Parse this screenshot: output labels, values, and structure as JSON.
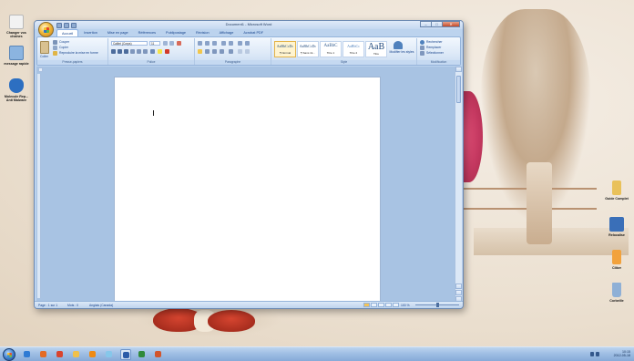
{
  "desktop": {
    "icons_left": [
      {
        "label": "Changer vos chaînes",
        "icon": "document-icon",
        "color": "#e8e8e8"
      },
      {
        "label": "message rapide",
        "icon": "envelope-icon",
        "color": "#8bb4e0"
      },
      {
        "label": "Molecule Rep... Anti Malware",
        "icon": "shield-icon",
        "color": "#2d6fc1"
      }
    ],
    "icons_right": [
      {
        "label": "Guide Complet",
        "icon": "folder-icon",
        "color": "#e9c15a"
      },
      {
        "label": "Relocalise",
        "icon": "computer-icon",
        "color": "#3a6fb8"
      },
      {
        "label": "Cliker",
        "icon": "cursor-icon",
        "color": "#f2a23c"
      },
      {
        "label": "Corbeille",
        "icon": "recycle-bin-icon",
        "color": "#8fb0d6"
      }
    ]
  },
  "word": {
    "title": "Document1 - Microsoft Word",
    "tabs": [
      "Accueil",
      "Insertion",
      "Mise en page",
      "Références",
      "Publipostage",
      "Révision",
      "Affichage",
      "Acrobat PDF"
    ],
    "active_tab": "Accueil",
    "clipboard": {
      "paste_label": "Coller",
      "cut": "Couper",
      "copy": "Copier",
      "format_painter": "Reproduire la mise en forme",
      "group_label": "Presse-papiers"
    },
    "font": {
      "name": "Calibri (Corps)",
      "size": "11",
      "group_label": "Police"
    },
    "paragraph": {
      "group_label": "Paragraphe"
    },
    "styles": {
      "items": [
        {
          "preview": "AaBbCcDc",
          "name": "¶ Normal",
          "selected": true
        },
        {
          "preview": "AaBbCcDc",
          "name": "¶ Sans int...",
          "selected": false
        },
        {
          "preview": "AaBbC",
          "name": "Titre 1",
          "selected": false
        },
        {
          "preview": "AaBbCc",
          "name": "Titre 2",
          "selected": false
        },
        {
          "preview": "AaB",
          "name": "Titre",
          "selected": false
        }
      ],
      "change_styles": "Modifier les styles",
      "group_label": "Style"
    },
    "editing": {
      "find": "Rechercher",
      "replace": "Remplacer",
      "select": "Sélectionner",
      "group_label": "Modification"
    },
    "status": {
      "page": "Page : 1 sur 1",
      "words": "Mots : 0",
      "language": "Anglais (Canada)",
      "zoom": "100 %",
      "zoom_fraction": 0.5
    }
  },
  "taskbar": {
    "apps": [
      {
        "icon": "ie-icon",
        "color": "#2f7bd4",
        "active": false
      },
      {
        "icon": "firefox-icon",
        "color": "#e46b25",
        "active": false
      },
      {
        "icon": "chrome-icon",
        "color": "#d9442f",
        "active": false
      },
      {
        "icon": "folder-icon",
        "color": "#f0c04b",
        "active": false
      },
      {
        "icon": "vlc-icon",
        "color": "#ef8a12",
        "active": false
      },
      {
        "icon": "paint-icon",
        "color": "#86c7ea",
        "active": false
      },
      {
        "icon": "word-icon",
        "color": "#2b5ca8",
        "active": true
      },
      {
        "icon": "excel-icon",
        "color": "#2f8a3b",
        "active": false
      },
      {
        "icon": "powerpoint-icon",
        "color": "#d2552c",
        "active": false
      }
    ],
    "clock_time": "10:15",
    "clock_date": "2012-05-18"
  }
}
